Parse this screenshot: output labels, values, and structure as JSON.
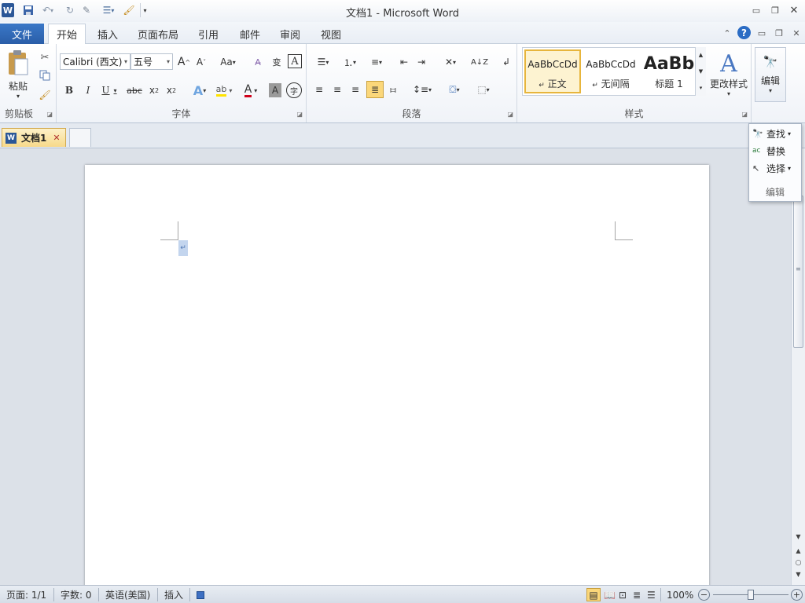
{
  "window": {
    "title": "文档1 - Microsoft Word"
  },
  "tabs": {
    "file": "文件",
    "items": [
      "开始",
      "插入",
      "页面布局",
      "引用",
      "邮件",
      "审阅",
      "视图"
    ]
  },
  "ribbon": {
    "clipboard": {
      "paste_label": "粘贴",
      "group_label": "剪贴板"
    },
    "font": {
      "font_name": "Calibri (西文)",
      "font_size": "五号",
      "group_label": "字体"
    },
    "paragraph": {
      "group_label": "段落"
    },
    "styles": {
      "items": [
        {
          "sample": "AaBbCcDd",
          "name": "正文"
        },
        {
          "sample": "AaBbCcDd",
          "name": "无间隔"
        },
        {
          "sample": "AaBb",
          "name": "标题 1"
        }
      ],
      "change_styles_label": "更改样式",
      "group_label": "样式"
    },
    "editing": {
      "label": "编辑"
    }
  },
  "document_tabs": {
    "active": "文档1"
  },
  "edit_dropdown": {
    "items": [
      "查找",
      "替换",
      "选择"
    ],
    "footer": "编辑"
  },
  "status_bar": {
    "page": "页面: 1/1",
    "words": "字数: 0",
    "language": "英语(美国)",
    "mode": "插入",
    "zoom": "100%"
  },
  "colors": {
    "file_tab": "#2a5ea8",
    "selection": "#c3d5ee",
    "font_color_underline": "#d0021b",
    "highlight_underline": "#ffe300"
  }
}
